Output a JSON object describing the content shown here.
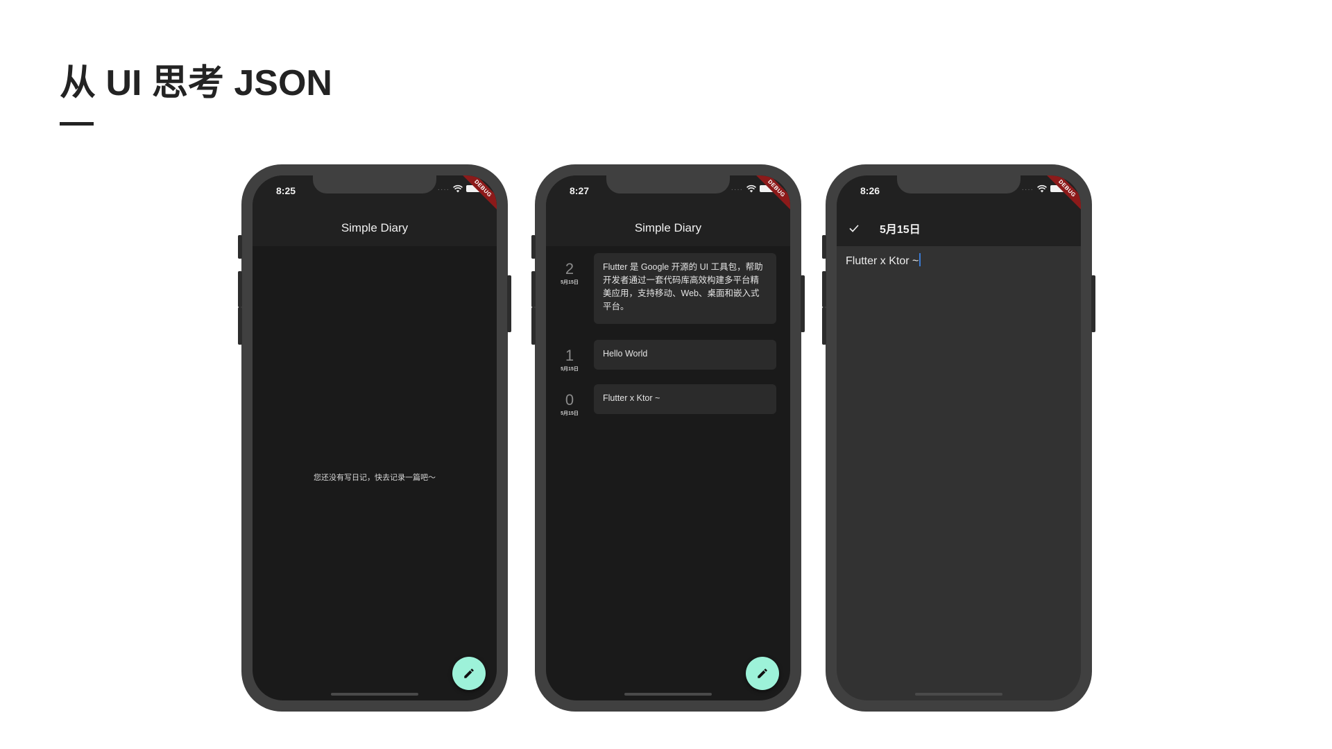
{
  "slide": {
    "title": "从 UI 思考 JSON"
  },
  "phones": [
    {
      "status_time": "8:25",
      "signal": "····",
      "debug_label": "DEBUG",
      "app_bar_title": "Simple Diary",
      "empty_message": "您还没有写日记，快去记录一篇吧～",
      "fab_icon": "pencil-icon",
      "fab_color": "#9df2d9"
    },
    {
      "status_time": "8:27",
      "signal": "····",
      "debug_label": "DEBUG",
      "app_bar_title": "Simple Diary",
      "entries": [
        {
          "index": "2",
          "date": "5月15日",
          "text": "Flutter 是 Google 开源的 UI 工具包，帮助开发者通过一套代码库高效构建多平台精美应用，支持移动、Web、桌面和嵌入式平台。"
        },
        {
          "index": "1",
          "date": "5月15日",
          "text": "Hello World"
        },
        {
          "index": "0",
          "date": "5月15日",
          "text": "Flutter x Ktor ~"
        }
      ],
      "fab_icon": "pencil-icon",
      "fab_color": "#9df2d9"
    },
    {
      "status_time": "8:26",
      "signal": "····",
      "debug_label": "DEBUG",
      "app_bar_icon": "check-icon",
      "app_bar_title": "5月15日",
      "editor_value": "Flutter x Ktor ~"
    }
  ]
}
